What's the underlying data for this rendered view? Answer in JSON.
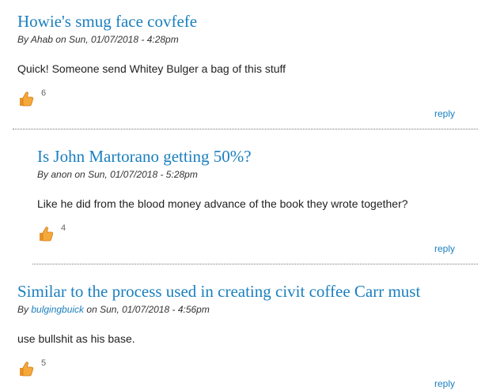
{
  "comments": [
    {
      "title": "Howie's smug face covfefe",
      "by_prefix": "By ",
      "author": "Ahab",
      "on_text": " on Sun, 01/07/2018 - 4:28pm",
      "body": "Quick! Someone send Whitey Bulger a bag of this stuff",
      "likes": "6",
      "reply": "reply"
    },
    {
      "title": "Is John Martorano getting 50%?",
      "by_prefix": "By ",
      "author": "anon",
      "on_text": " on Sun, 01/07/2018 - 5:28pm",
      "body": "Like he did from the blood money advance of the book they wrote together?",
      "likes": "4",
      "reply": "reply"
    },
    {
      "title": "Similar to the process used in creating civit coffee Carr must",
      "by_prefix": "By ",
      "author": "bulgingbuick",
      "on_text": " on Sun, 01/07/2018 - 4:56pm",
      "body": "use bullshit as his base.",
      "likes": "5",
      "reply": "reply"
    }
  ],
  "icons": {
    "like": "thumbs-up-icon"
  },
  "colors": {
    "link": "#1a7fbf",
    "thumb": "#f0a030"
  }
}
